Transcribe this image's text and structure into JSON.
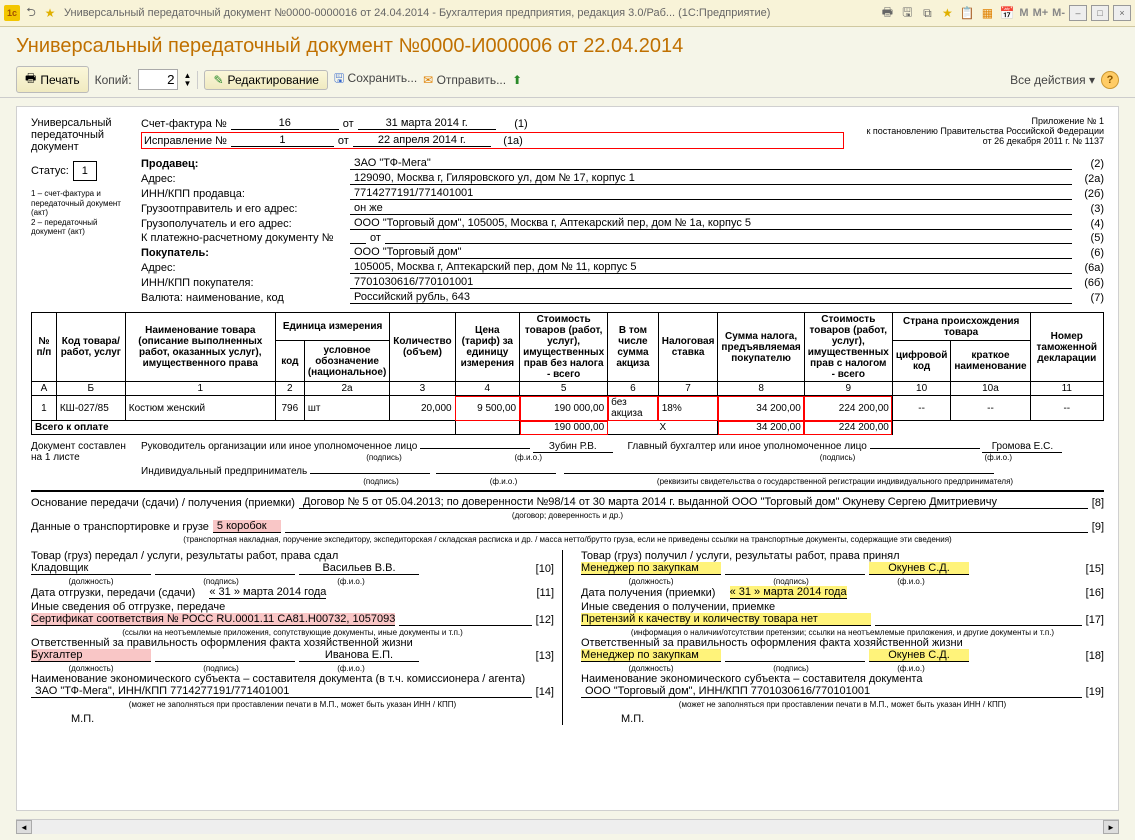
{
  "titlebar": {
    "text": "Универсальный передаточный документ №0000-0000016 от 24.04.2014 - Бухгалтерия предприятия, редакция 3.0/Раб...  (1С:Предприятие)",
    "mem": [
      "M",
      "M+",
      "M-"
    ]
  },
  "header": {
    "title": "Универсальный передаточный документ №0000-И000006 от 22.04.2014"
  },
  "toolbar": {
    "print": "Печать",
    "copies_label": "Копий:",
    "copies_value": "2",
    "edit": "Редактирование",
    "save": "Сохранить...",
    "send": "Отправить...",
    "all_actions": "Все действия"
  },
  "left": {
    "doc_label1": "Универсальный",
    "doc_label2": "передаточный",
    "doc_label3": "документ",
    "status_label": "Статус:",
    "status_value": "1",
    "legend": "1 – счет-фактура и передаточный документ (акт)\n2 – передаточный документ (акт)"
  },
  "rhs": {
    "line1": "Приложение № 1",
    "line2": "к постановлению Правительства Российской Федерации",
    "line3": "от 26 декабря 2011 г. № 1137"
  },
  "rows": {
    "sf_no_label": "Счет-фактура №",
    "sf_no": "16",
    "sf_from": "от",
    "sf_date": "31 марта 2014 г.",
    "sf_paren": "(1)",
    "corr_label": "Исправление №",
    "corr_no": "1",
    "corr_from": "от",
    "corr_date": "22 апреля 2014 г.",
    "corr_paren": "(1а)",
    "seller_label": "Продавец:",
    "seller": "ЗАО \"ТФ-Мега\"",
    "p2": "(2)",
    "addr_label": "Адрес:",
    "addr": "129090, Москва г, Гиляровского ул, дом № 17, корпус 1",
    "p2a": "(2а)",
    "inn_s_label": "ИНН/КПП продавца:",
    "inn_s": "7714277191/771401001",
    "p2b": "(2б)",
    "shipper_label": "Грузоотправитель и его адрес:",
    "shipper": "он же",
    "p3": "(3)",
    "consignee_label": "Грузополучатель и его адрес:",
    "consignee": "ООО \"Торговый дом\", 105005, Москва г, Аптекарский пер, дом № 1а, корпус 5",
    "p4": "(4)",
    "paydoc_label": "К платежно-расчетному документу №",
    "paydoc": "",
    "paydoc_from": "от",
    "p5": "(5)",
    "buyer_label": "Покупатель:",
    "buyer": "ООО \"Торговый дом\"",
    "p6": "(6)",
    "baddr_label": "Адрес:",
    "baddr": "105005, Москва г, Аптекарский пер, дом № 11, корпус 5",
    "p6a": "(6а)",
    "inn_b_label": "ИНН/КПП покупателя:",
    "inn_b": "7701030616/770101001",
    "p6b": "(6б)",
    "currency_label": "Валюта: наименование, код",
    "currency": "Российский рубль, 643",
    "p7": "(7)"
  },
  "table": {
    "h_no": "№ п/п",
    "h_code": "Код товара/ работ, услуг",
    "h_name": "Наименование товара (описание выполненных работ, оказанных услуг), имущественного права",
    "h_unit": "Единица измерения",
    "h_unit_code": "код",
    "h_unit_name": "условное обозначение (национальное)",
    "h_qty": "Количество (объем)",
    "h_price": "Цена (тариф) за единицу измерения",
    "h_cost_notax": "Стоимость товаров (работ, услуг), имущественных прав без налога - всего",
    "h_excise": "В том числе сумма акциза",
    "h_rate": "Налоговая ставка",
    "h_tax": "Сумма налога, предъявляемая покупателю",
    "h_cost_tax": "Стоимость товаров (работ, услуг), имущественных прав с налогом - всего",
    "h_country": "Страна происхождения товара",
    "h_ccode": "цифровой код",
    "h_cname": "краткое наименование",
    "h_decl": "Номер таможенной декларации",
    "colnums": [
      "А",
      "Б",
      "1",
      "2",
      "2а",
      "3",
      "4",
      "5",
      "6",
      "7",
      "8",
      "9",
      "10",
      "10а",
      "11"
    ],
    "row": {
      "n": "1",
      "code": "КШ-027/85",
      "name": "Костюм женский",
      "ucode": "796",
      "uname": "шт",
      "qty": "20,000",
      "price": "9 500,00",
      "cost_notax": "190 000,00",
      "excise": "без акциза",
      "rate": "18%",
      "tax": "34 200,00",
      "cost_tax": "224 200,00",
      "ccode": "--",
      "cname": "--",
      "decl": "--"
    },
    "total_label": "Всего к оплате",
    "total_notax": "190 000,00",
    "total_x": "Х",
    "total_tax": "34 200,00",
    "total_withtax": "224 200,00"
  },
  "sig": {
    "doc_on_label": "Документ составлен на 1 листе",
    "head_label": "Руководитель организации или иное уполномоченное лицо",
    "head_name": "Зубин Р.В.",
    "chief_label": "Главный бухгалтер или иное уполномоченное лицо",
    "chief_name": "Громова Е.С.",
    "ip_label": "Индивидуальный предприниматель",
    "subcap_sign": "(подпись)",
    "subcap_fio": "(ф.и.о.)",
    "subcap_req": "(реквизиты свидетельства о государственной регистрации индивидуального предпринимателя)"
  },
  "transfer": {
    "basis_label": "Основание передачи (сдачи) / получения (приемки)",
    "basis_val": "Договор № 5 от 05.04.2013; по доверенности №98/14 от 30 марта 2014 г.  выданной ООО \"Торговый дом\" Окуневу Сергею Дмитриевичу",
    "basis_sub": "(договор; доверенность и др.)",
    "p8": "[8]",
    "trans_label": "Данные о транспортировке и грузе",
    "trans_val": "5 коробок",
    "trans_sub": "(транспортная накладная, поручение экспедитору, экспедиторская / складская расписка и др. / масса нетто/брутто груза, если не приведены ссылки на транспортные документы, содержащие эти сведения)",
    "p9": "[9]"
  },
  "left_block": {
    "passed_label": "Товар (груз) передал / услуги, результаты работ, права сдал",
    "pos1": "Кладовщик",
    "name1": "Васильев В.В.",
    "p10": "[10]",
    "date_label": "Дата отгрузки, передачи (сдачи)",
    "date_val": "« 31 »   марта   2014  года",
    "p11": "[11]",
    "other_label": "Иные сведения об отгрузке, передаче",
    "other_val": "Сертификат соответствия № РОСС RU.0001.11 CA81.H00732, 1057093",
    "p12": "[12]",
    "other_sub": "(ссылки на неотъемлемые приложения, сопутствующие документы, иные документы и т.п.)",
    "resp_label": "Ответственный за правильность оформления факта хозяйственной жизни",
    "pos2": "Бухгалтер",
    "name2": "Иванова Е.П.",
    "p13": "[13]",
    "econ_label": "Наименование экономического субъекта – составителя документа (в т.ч. комиссионера / агента)",
    "econ_val": "ЗАО \"ТФ-Мега\", ИНН/КПП 7714277191/771401001",
    "p14": "[14]",
    "econ_sub": "(может не заполняться при проставлении печати в М.П., может быть указан ИНН / КПП)",
    "mp": "М.П.",
    "subcap_pos": "(должность)"
  },
  "right_block": {
    "received_label": "Товар (груз) получил / услуги, результаты работ, права принял",
    "pos1": "Менеджер по закупкам",
    "name1": "Окунев С.Д.",
    "p15": "[15]",
    "date_label": "Дата получения (приемки)",
    "date_val": "« 31 »   марта   2014  года",
    "p16": "[16]",
    "other_label": "Иные сведения о получении, приемке",
    "other_val": "Претензий к качеству и количеству товара нет",
    "p17": "[17]",
    "other_sub": "(информация о наличии/отсутствии претензии; ссылки на неотъемлемые приложения, и другие документы и т.п.)",
    "resp_label": "Ответственный за правильность оформления факта хозяйственной жизни",
    "pos2": "Менеджер по закупкам",
    "name2": "Окунев С.Д.",
    "p18": "[18]",
    "econ_label": "Наименование экономического субъекта – составителя документа",
    "econ_val": "ООО \"Торговый дом\", ИНН/КПП 7701030616/770101001",
    "p19": "[19]",
    "econ_sub": "(может не заполняться при проставлении печати в М.П., может быть указан ИНН / КПП)",
    "mp": "М.П."
  }
}
